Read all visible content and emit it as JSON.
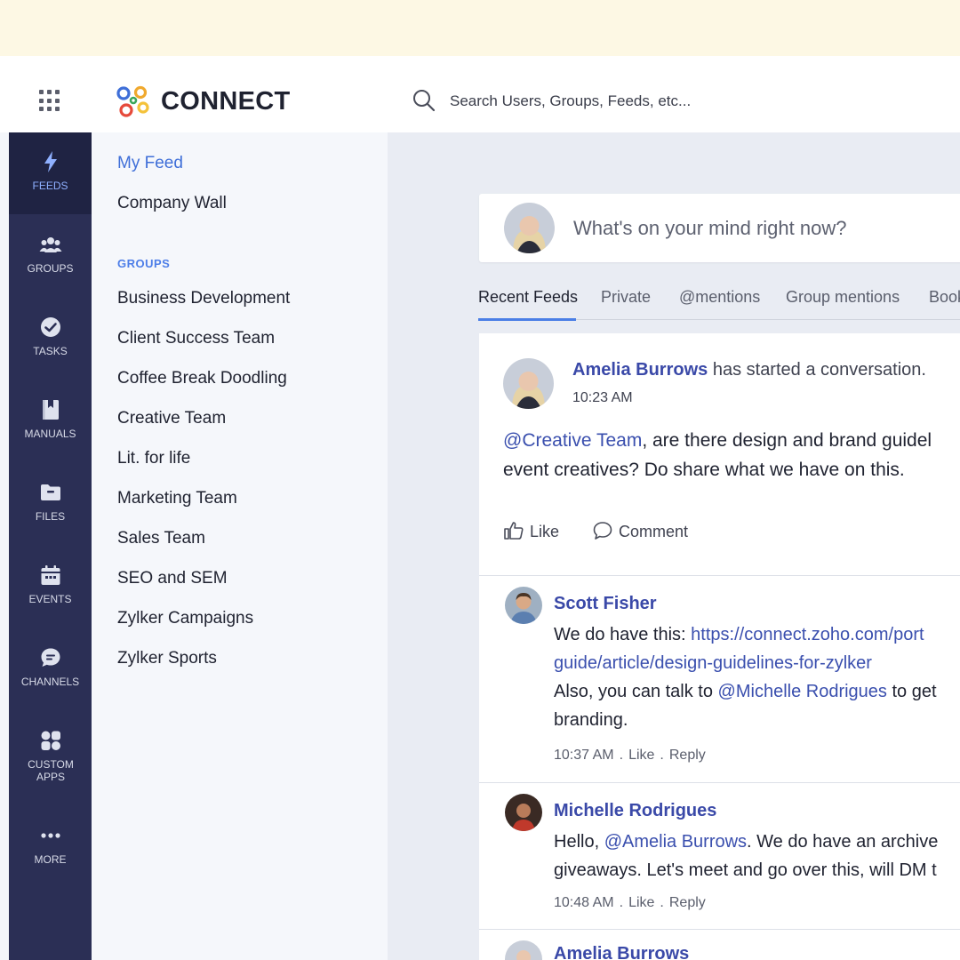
{
  "app": {
    "name": "CONNECT"
  },
  "search": {
    "placeholder": "Search Users, Groups, Feeds, etc..."
  },
  "sidebar": {
    "items": [
      {
        "label": "FEEDS",
        "icon": "lightning-icon",
        "active": true
      },
      {
        "label": "GROUPS",
        "icon": "people-icon"
      },
      {
        "label": "TASKS",
        "icon": "check-circle-icon"
      },
      {
        "label": "MANUALS",
        "icon": "book-icon"
      },
      {
        "label": "FILES",
        "icon": "folder-icon"
      },
      {
        "label": "EVENTS",
        "icon": "calendar-icon"
      },
      {
        "label": "CHANNELS",
        "icon": "chat-icon"
      },
      {
        "label": "CUSTOM APPS",
        "icon": "apps-icon"
      },
      {
        "label": "MORE",
        "icon": "more-icon"
      }
    ]
  },
  "panel": {
    "links": [
      "My Feed",
      "Company Wall"
    ],
    "groups_heading": "GROUPS",
    "groups": [
      "Business Development",
      "Client Success Team",
      "Coffee Break Doodling",
      "Creative Team",
      "Lit. for life",
      "Marketing Team",
      "Sales Team",
      "SEO and SEM",
      "Zylker Campaigns",
      "Zylker Sports"
    ]
  },
  "composer": {
    "placeholder": "What's on your mind right now?"
  },
  "tabs": [
    "Recent Feeds",
    "Private",
    "@mentions",
    "Group mentions",
    "Book"
  ],
  "post": {
    "author": "Amelia Burrows",
    "action": "has started a conversation.",
    "time": "10:23 AM",
    "mention": "@Creative Team",
    "line1_rest": ", are there design and brand guidel",
    "line2": "event creatives? Do share what we have on this.",
    "like_label": "Like",
    "comment_label": "Comment"
  },
  "comments": [
    {
      "author": "Scott Fisher",
      "line1_prefix": "We do have this: ",
      "line1_link": "https://connect.zoho.com/port",
      "line2_link": "guide/article/design-guidelines-for-zylker",
      "line3_prefix": "Also, you can talk to ",
      "line3_mention": "@Michelle Rodrigues",
      "line3_suffix": " to get",
      "line4": "branding.",
      "time": "10:37 AM",
      "like": "Like",
      "reply": "Reply"
    },
    {
      "author": "Michelle Rodrigues",
      "line1_prefix": "Hello, ",
      "line1_mention": "@Amelia Burrows",
      "line1_suffix": ". We do have an archive",
      "line2": "giveaways. Let's meet and go over this, will DM t",
      "time": "10:48 AM",
      "like": "Like",
      "reply": "Reply"
    },
    {
      "author": "Amelia Burrows"
    }
  ],
  "separator": ".",
  "colors": {
    "sidebar_bg": "#2b2f55",
    "sidebar_active_bg": "#1f2343",
    "accent_blue": "#4a7ee6",
    "author_blue": "#3a49a8",
    "banner_cream": "#fdf8e4"
  }
}
